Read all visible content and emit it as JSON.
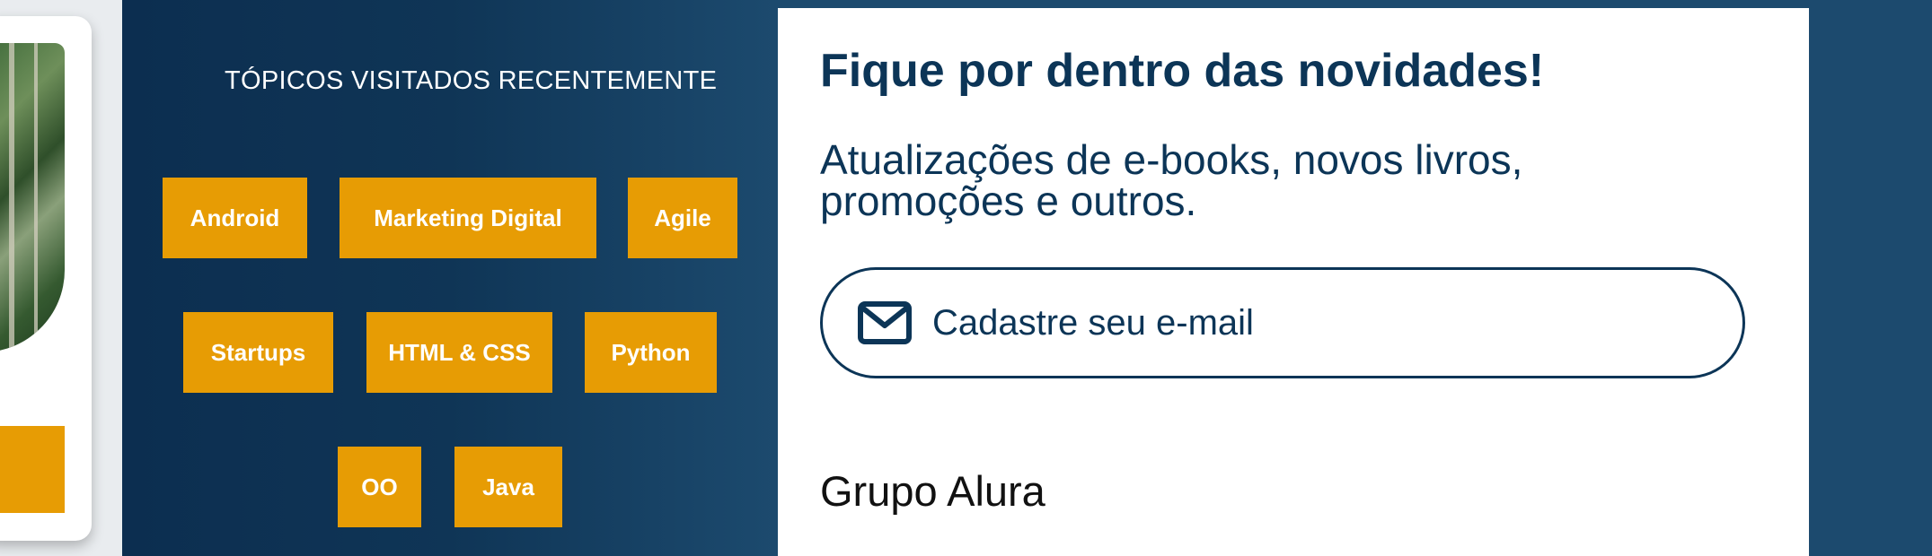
{
  "topics": {
    "title": "TÓPICOS VISITADOS RECENTEMENTE",
    "chips": [
      {
        "label": "Android"
      },
      {
        "label": "Marketing Digital"
      },
      {
        "label": "Agile"
      },
      {
        "label": "Startups"
      },
      {
        "label": "HTML & CSS"
      },
      {
        "label": "Python"
      },
      {
        "label": "OO"
      },
      {
        "label": "Java"
      }
    ]
  },
  "newsletter": {
    "heading": "Fique por dentro das novidades!",
    "subtext": "Atualizações de e-books, novos livros, promoções e outros.",
    "email_button_label": "Cadastre seu e-mail",
    "email_icon": "mail-icon"
  },
  "footer": {
    "group_label": "Grupo Alura"
  },
  "colors": {
    "chip_bg": "#e79c04",
    "panel_navy": "#0c2e50",
    "text_navy": "#0c3557",
    "page_bg": "#1c4a6e"
  }
}
